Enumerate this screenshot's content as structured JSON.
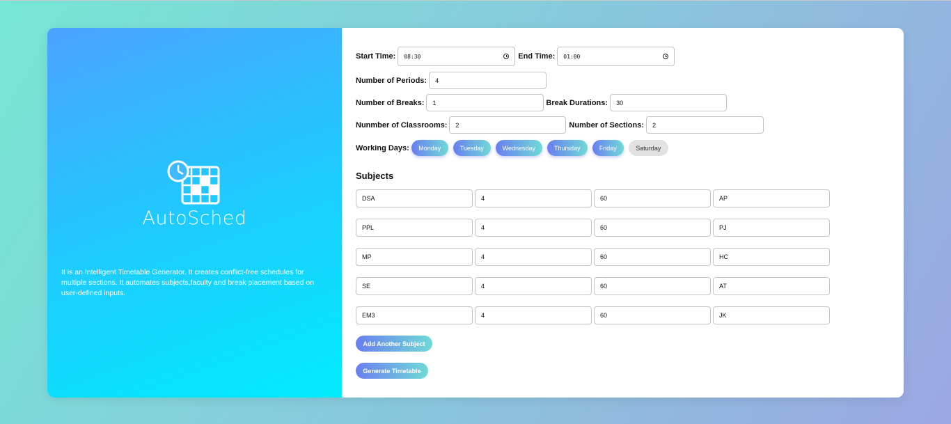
{
  "brand": {
    "name": "AutoSched",
    "description": "It is an Intelligent Timetable Generator. It creates conflict-free schedules for multiple sections. It automates subjects,faculty and break placement based on user-defined inputs."
  },
  "form": {
    "start_time": {
      "label": "Start Time:",
      "value": "08:30"
    },
    "end_time": {
      "label": "End Time:",
      "value": "01:00"
    },
    "num_periods": {
      "label": "Number of Periods:",
      "value": "4"
    },
    "num_breaks": {
      "label": "Number of Breaks:",
      "value": "1"
    },
    "break_durations": {
      "label": "Break Durations:",
      "value": "30"
    },
    "num_classrooms": {
      "label": "Nunmber of Classrooms:",
      "value": "2"
    },
    "num_sections": {
      "label": "Number of Sections:",
      "value": "2"
    },
    "working_days": {
      "label": "Working Days:",
      "days": [
        {
          "name": "Monday",
          "selected": true
        },
        {
          "name": "Tuesday",
          "selected": true
        },
        {
          "name": "Wednesday",
          "selected": true
        },
        {
          "name": "Thursday",
          "selected": true
        },
        {
          "name": "Friday",
          "selected": true
        },
        {
          "name": "Saturday",
          "selected": false
        }
      ]
    }
  },
  "subjects": {
    "title": "Subjects",
    "rows": [
      [
        "DSA",
        "4",
        "60",
        "AP"
      ],
      [
        "PPL",
        "4",
        "60",
        "PJ"
      ],
      [
        "MP",
        "4",
        "60",
        "HC"
      ],
      [
        "SE",
        "4",
        "60",
        "AT"
      ],
      [
        "EM3",
        "4",
        "60",
        "JK"
      ]
    ]
  },
  "buttons": {
    "add_subject": "Add Another Subject",
    "generate": "Generate Timetable"
  },
  "colors": {
    "accent_start": "#6a7ef0",
    "accent_end": "#6fdad6",
    "panel_start": "#4ca3ff",
    "panel_end": "#00ecfb"
  }
}
